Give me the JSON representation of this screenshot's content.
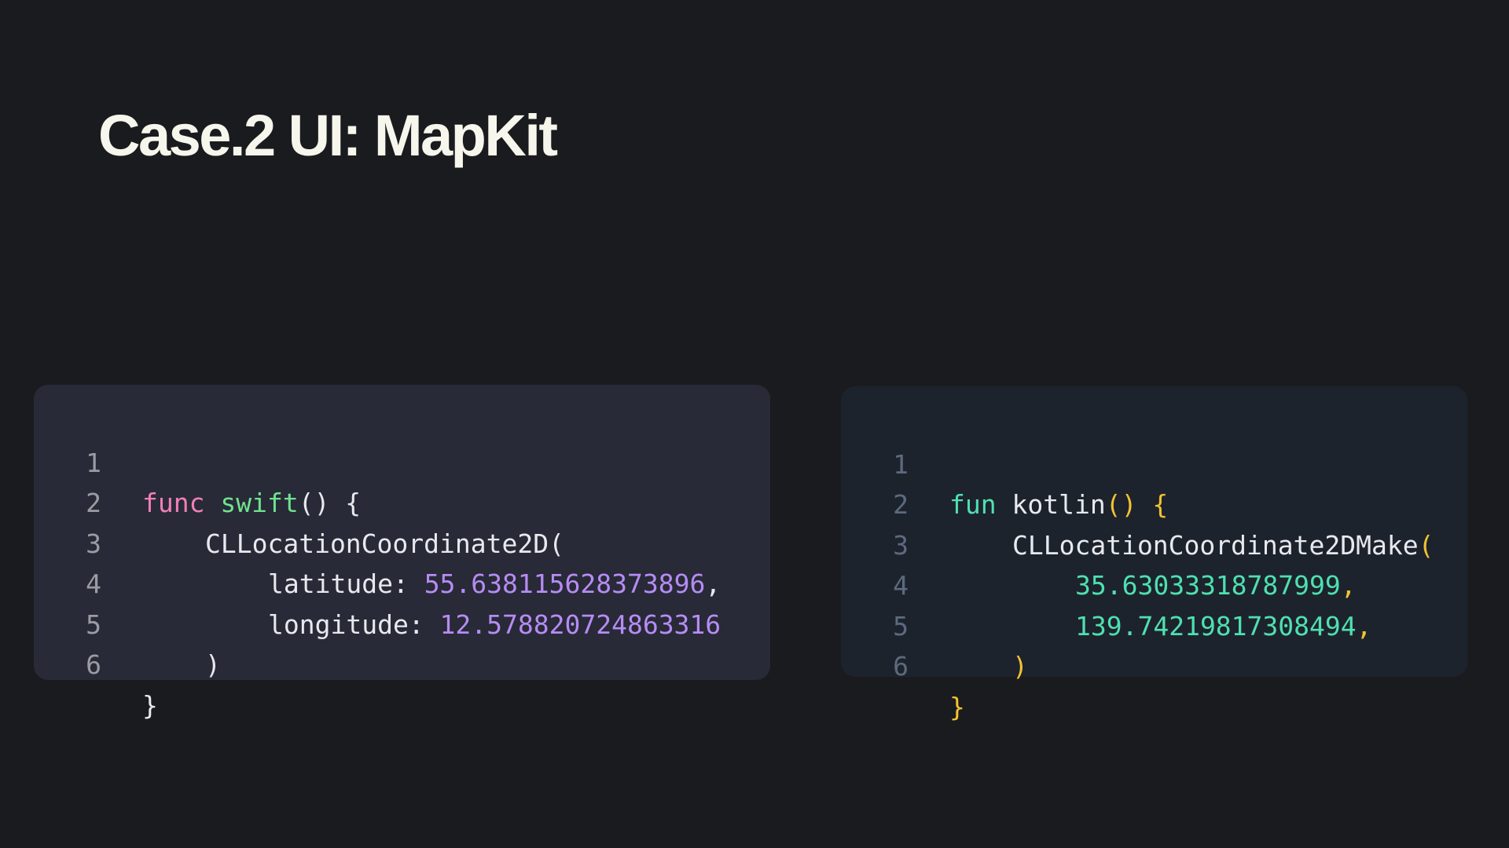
{
  "slide": {
    "title": "Case.2 UI: MapKit"
  },
  "swift_code": {
    "line_numbers": [
      "1",
      "2",
      "3",
      "4",
      "5",
      "6"
    ],
    "func_keyword": "func",
    "func_name": "swift",
    "func_open": "() {",
    "constructor": "CLLocationCoordinate2D(",
    "lat_label": "latitude: ",
    "lat_value": "55.638115628373896",
    "lat_comma": ",",
    "lon_label": "longitude: ",
    "lon_value": "12.578820724863316",
    "close_paren": ")",
    "close_brace": "}"
  },
  "kotlin_code": {
    "line_numbers": [
      "1",
      "2",
      "3",
      "4",
      "5",
      "6"
    ],
    "fun_keyword": "fun",
    "fun_name": "kotlin",
    "fun_parens": "()",
    "fun_open_brace": "{",
    "constructor": "CLLocationCoordinate2DMake",
    "constructor_open": "(",
    "lat_value": "35.63033318787999",
    "lat_comma": ",",
    "lon_value": "139.74219817308494",
    "lon_comma": ",",
    "close_paren": ")",
    "close_brace": "}"
  },
  "colors": {
    "background": "#1a1b1e",
    "title": "#f7f6ec",
    "swift_panel": "#282a37",
    "kotlin_panel": "#1d232d",
    "swift_keyword": "#f07fb8",
    "swift_function": "#6fe28f",
    "swift_number": "#b68cf4",
    "kotlin_keyword": "#4fe0b0",
    "kotlin_bracket": "#f2c230",
    "kotlin_number": "#4fe0b0"
  }
}
